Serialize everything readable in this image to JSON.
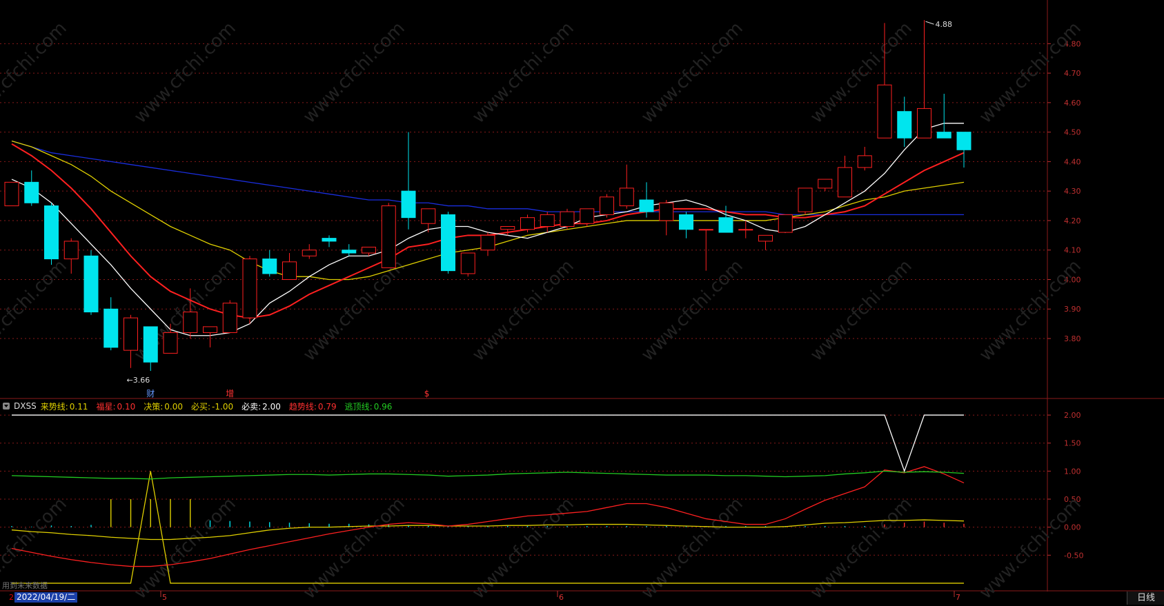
{
  "chart_data": [
    {
      "type": "candlestick",
      "ylim": [
        3.62,
        4.92
      ],
      "yticks": [
        "4.80",
        "4.70",
        "4.60",
        "4.50",
        "4.40",
        "4.30",
        "4.20",
        "4.10",
        "4.00",
        "3.90",
        "3.80"
      ],
      "candles": [
        {
          "o": 4.25,
          "h": 4.33,
          "l": 4.25,
          "c": 4.33
        },
        {
          "o": 4.33,
          "h": 4.37,
          "l": 4.25,
          "c": 4.26
        },
        {
          "o": 4.25,
          "h": 4.26,
          "l": 4.05,
          "c": 4.07
        },
        {
          "o": 4.07,
          "h": 4.14,
          "l": 4.02,
          "c": 4.13
        },
        {
          "o": 4.08,
          "h": 4.1,
          "l": 3.88,
          "c": 3.89
        },
        {
          "o": 3.9,
          "h": 3.94,
          "l": 3.76,
          "c": 3.77
        },
        {
          "o": 3.76,
          "h": 3.88,
          "l": 3.7,
          "c": 3.87
        },
        {
          "o": 3.84,
          "h": 3.84,
          "l": 3.69,
          "c": 3.72
        },
        {
          "o": 3.75,
          "h": 3.85,
          "l": 3.75,
          "c": 3.82
        },
        {
          "o": 3.82,
          "h": 3.97,
          "l": 3.8,
          "c": 3.89
        },
        {
          "o": 3.82,
          "h": 3.84,
          "l": 3.77,
          "c": 3.84
        },
        {
          "o": 3.82,
          "h": 3.93,
          "l": 3.82,
          "c": 3.92
        },
        {
          "o": 3.87,
          "h": 4.08,
          "l": 3.85,
          "c": 4.07
        },
        {
          "o": 4.07,
          "h": 4.1,
          "l": 4.01,
          "c": 4.02
        },
        {
          "o": 4.0,
          "h": 4.09,
          "l": 4.0,
          "c": 4.06
        },
        {
          "o": 4.08,
          "h": 4.12,
          "l": 4.07,
          "c": 4.1
        },
        {
          "o": 4.14,
          "h": 4.15,
          "l": 4.11,
          "c": 4.13
        },
        {
          "o": 4.1,
          "h": 4.12,
          "l": 4.08,
          "c": 4.09
        },
        {
          "o": 4.09,
          "h": 4.11,
          "l": 4.08,
          "c": 4.11
        },
        {
          "o": 4.04,
          "h": 4.26,
          "l": 4.04,
          "c": 4.25
        },
        {
          "o": 4.3,
          "h": 4.5,
          "l": 4.17,
          "c": 4.21
        },
        {
          "o": 4.19,
          "h": 4.24,
          "l": 4.16,
          "c": 4.24
        },
        {
          "o": 4.22,
          "h": 4.23,
          "l": 4.02,
          "c": 4.03
        },
        {
          "o": 4.02,
          "h": 4.09,
          "l": 4.01,
          "c": 4.09
        },
        {
          "o": 4.1,
          "h": 4.16,
          "l": 4.08,
          "c": 4.15
        },
        {
          "o": 4.17,
          "h": 4.18,
          "l": 4.15,
          "c": 4.18
        },
        {
          "o": 4.17,
          "h": 4.22,
          "l": 4.16,
          "c": 4.21
        },
        {
          "o": 4.18,
          "h": 4.23,
          "l": 4.16,
          "c": 4.22
        },
        {
          "o": 4.18,
          "h": 4.24,
          "l": 4.17,
          "c": 4.23
        },
        {
          "o": 4.19,
          "h": 4.24,
          "l": 4.18,
          "c": 4.24
        },
        {
          "o": 4.22,
          "h": 4.29,
          "l": 4.21,
          "c": 4.28
        },
        {
          "o": 4.25,
          "h": 4.39,
          "l": 4.24,
          "c": 4.31
        },
        {
          "o": 4.27,
          "h": 4.33,
          "l": 4.21,
          "c": 4.23
        },
        {
          "o": 4.2,
          "h": 4.27,
          "l": 4.15,
          "c": 4.26
        },
        {
          "o": 4.22,
          "h": 4.23,
          "l": 4.14,
          "c": 4.17
        },
        {
          "o": 4.17,
          "h": 4.17,
          "l": 4.03,
          "c": 4.17
        },
        {
          "o": 4.21,
          "h": 4.25,
          "l": 4.16,
          "c": 4.16
        },
        {
          "o": 4.17,
          "h": 4.2,
          "l": 4.14,
          "c": 4.17
        },
        {
          "o": 4.13,
          "h": 4.15,
          "l": 4.1,
          "c": 4.15
        },
        {
          "o": 4.16,
          "h": 4.22,
          "l": 4.16,
          "c": 4.22
        },
        {
          "o": 4.23,
          "h": 4.31,
          "l": 4.22,
          "c": 4.31
        },
        {
          "o": 4.31,
          "h": 4.34,
          "l": 4.3,
          "c": 4.34
        },
        {
          "o": 4.28,
          "h": 4.42,
          "l": 4.28,
          "c": 4.38
        },
        {
          "o": 4.38,
          "h": 4.45,
          "l": 4.37,
          "c": 4.42
        },
        {
          "o": 4.48,
          "h": 4.87,
          "l": 4.48,
          "c": 4.66
        },
        {
          "o": 4.57,
          "h": 4.62,
          "l": 4.45,
          "c": 4.48
        },
        {
          "o": 4.48,
          "h": 4.88,
          "l": 4.48,
          "c": 4.58
        },
        {
          "o": 4.5,
          "h": 4.63,
          "l": 4.48,
          "c": 4.48
        },
        {
          "o": 4.5,
          "h": 4.5,
          "l": 4.38,
          "c": 4.44
        }
      ],
      "ma_colors": [
        "#ffffff",
        "#ff2020",
        "#e0d000",
        "#1a2ee0"
      ],
      "ma_white": [
        4.34,
        4.31,
        4.26,
        4.19,
        4.12,
        4.05,
        3.97,
        3.9,
        3.83,
        3.81,
        3.81,
        3.82,
        3.85,
        3.92,
        3.96,
        4.01,
        4.05,
        4.08,
        4.08,
        4.1,
        4.14,
        4.17,
        4.18,
        4.18,
        4.16,
        4.15,
        4.14,
        4.16,
        4.18,
        4.21,
        4.22,
        4.23,
        4.25,
        4.26,
        4.27,
        4.25,
        4.22,
        4.2,
        4.17,
        4.16,
        4.18,
        4.22,
        4.26,
        4.3,
        4.36,
        4.44,
        4.51,
        4.53,
        4.53
      ],
      "ma_red": [
        4.46,
        4.42,
        4.37,
        4.31,
        4.24,
        4.16,
        4.08,
        4.01,
        3.96,
        3.93,
        3.9,
        3.88,
        3.87,
        3.88,
        3.91,
        3.95,
        3.98,
        4.01,
        4.04,
        4.07,
        4.11,
        4.12,
        4.14,
        4.15,
        4.15,
        4.16,
        4.17,
        4.18,
        4.19,
        4.19,
        4.2,
        4.22,
        4.23,
        4.24,
        4.24,
        4.24,
        4.23,
        4.22,
        4.22,
        4.21,
        4.21,
        4.22,
        4.23,
        4.25,
        4.29,
        4.33,
        4.37,
        4.4,
        4.43
      ],
      "ma_yellow": [
        4.47,
        4.45,
        4.42,
        4.39,
        4.35,
        4.3,
        4.26,
        4.22,
        4.18,
        4.15,
        4.12,
        4.1,
        4.06,
        4.03,
        4.01,
        4.01,
        4.0,
        4.0,
        4.01,
        4.03,
        4.05,
        4.07,
        4.09,
        4.1,
        4.11,
        4.13,
        4.15,
        4.16,
        4.17,
        4.18,
        4.19,
        4.2,
        4.2,
        4.2,
        4.2,
        4.2,
        4.2,
        4.2,
        4.2,
        4.21,
        4.22,
        4.23,
        4.25,
        4.27,
        4.28,
        4.3,
        4.31,
        4.32,
        4.33
      ],
      "ma_blue": [
        4.47,
        4.45,
        4.43,
        4.42,
        4.41,
        4.4,
        4.39,
        4.38,
        4.37,
        4.36,
        4.35,
        4.34,
        4.33,
        4.32,
        4.31,
        4.3,
        4.29,
        4.28,
        4.27,
        4.27,
        4.26,
        4.26,
        4.25,
        4.25,
        4.24,
        4.24,
        4.24,
        4.23,
        4.23,
        4.23,
        4.23,
        4.23,
        4.23,
        4.23,
        4.23,
        4.23,
        4.23,
        4.23,
        4.23,
        4.22,
        4.22,
        4.22,
        4.22,
        4.22,
        4.22,
        4.22,
        4.22,
        4.22,
        4.22
      ],
      "low_annotation": {
        "text": "←3.66",
        "value": 3.66,
        "index": 6
      },
      "high_annotation": {
        "text": "4.88",
        "value": 4.88,
        "index": 46
      },
      "event_markers": [
        {
          "text": "财",
          "index": 7,
          "color": "#6699ff"
        },
        {
          "text": "增",
          "index": 11,
          "color": "#ff3333"
        },
        {
          "text": "$",
          "index": 21,
          "color": "#ff3333"
        }
      ]
    },
    {
      "type": "line",
      "indicator": "DXSS",
      "ylim": [
        -1.05,
        2.05
      ],
      "yticks": [
        "2.00",
        "1.50",
        "1.00",
        "0.50",
        "0.00",
        "-0.50"
      ],
      "legend": [
        {
          "label": "来势线:",
          "value": "0.11",
          "color": "#e0d000"
        },
        {
          "label": "福星:",
          "value": "0.10",
          "color": "#ff3030"
        },
        {
          "label": "决策:",
          "value": "0.00",
          "color": "#e0d000"
        },
        {
          "label": "必买:",
          "value": "-1.00",
          "color": "#e0d000"
        },
        {
          "label": "必卖:",
          "value": "2.00",
          "color": "#ffffff"
        },
        {
          "label": "趋势线:",
          "value": "0.79",
          "color": "#ff3030"
        },
        {
          "label": "逃顶线:",
          "value": "0.96",
          "color": "#22cc22"
        }
      ],
      "white_line": [
        2.0,
        2.0,
        2.0,
        2.0,
        2.0,
        2.0,
        2.0,
        2.0,
        2.0,
        2.0,
        2.0,
        2.0,
        2.0,
        2.0,
        2.0,
        2.0,
        2.0,
        2.0,
        2.0,
        2.0,
        2.0,
        2.0,
        2.0,
        2.0,
        2.0,
        2.0,
        2.0,
        2.0,
        2.0,
        2.0,
        2.0,
        2.0,
        2.0,
        2.0,
        2.0,
        2.0,
        2.0,
        2.0,
        2.0,
        2.0,
        2.0,
        2.0,
        2.0,
        2.0,
        2.0,
        1.0,
        2.0,
        2.0,
        2.0
      ],
      "yellow_spike": [
        -1.0,
        -1.0,
        -1.0,
        -1.0,
        -1.0,
        -1.0,
        -1.0,
        1.0,
        -1.0,
        -1.0,
        -1.0,
        -1.0,
        -1.0,
        -1.0,
        -1.0,
        -1.0,
        -1.0,
        -1.0,
        -1.0,
        -1.0,
        -1.0,
        -1.0,
        -1.0,
        -1.0,
        -1.0,
        -1.0,
        -1.0,
        -1.0,
        -1.0,
        -1.0,
        -1.0,
        -1.0,
        -1.0,
        -1.0,
        -1.0,
        -1.0,
        -1.0,
        -1.0,
        -1.0,
        -1.0,
        -1.0,
        -1.0,
        -1.0,
        -1.0,
        -1.0,
        -1.0,
        -1.0,
        -1.0,
        -1.0
      ],
      "green_line": [
        0.92,
        0.91,
        0.9,
        0.89,
        0.88,
        0.87,
        0.87,
        0.86,
        0.88,
        0.89,
        0.9,
        0.91,
        0.92,
        0.93,
        0.94,
        0.94,
        0.93,
        0.94,
        0.95,
        0.95,
        0.94,
        0.93,
        0.91,
        0.92,
        0.93,
        0.95,
        0.96,
        0.97,
        0.98,
        0.97,
        0.96,
        0.95,
        0.94,
        0.93,
        0.93,
        0.93,
        0.92,
        0.92,
        0.91,
        0.9,
        0.91,
        0.92,
        0.95,
        0.97,
        1.0,
        0.98,
        0.99,
        0.98,
        0.96
      ],
      "red_line": [
        -0.38,
        -0.45,
        -0.52,
        -0.58,
        -0.63,
        -0.67,
        -0.7,
        -0.7,
        -0.67,
        -0.62,
        -0.56,
        -0.48,
        -0.4,
        -0.33,
        -0.26,
        -0.19,
        -0.12,
        -0.06,
        0.0,
        0.05,
        0.08,
        0.06,
        0.02,
        0.05,
        0.1,
        0.15,
        0.2,
        0.22,
        0.25,
        0.28,
        0.35,
        0.42,
        0.42,
        0.35,
        0.25,
        0.15,
        0.1,
        0.05,
        0.05,
        0.15,
        0.32,
        0.48,
        0.6,
        0.72,
        1.02,
        0.97,
        1.08,
        0.95,
        0.79
      ],
      "yellow_line": [
        -0.05,
        -0.08,
        -0.1,
        -0.13,
        -0.15,
        -0.18,
        -0.2,
        -0.22,
        -0.22,
        -0.2,
        -0.18,
        -0.15,
        -0.1,
        -0.05,
        -0.02,
        0.0,
        0.0,
        0.01,
        0.02,
        0.02,
        0.03,
        0.03,
        0.02,
        0.02,
        0.02,
        0.03,
        0.03,
        0.04,
        0.04,
        0.05,
        0.05,
        0.05,
        0.04,
        0.03,
        0.02,
        0.01,
        0.0,
        0.0,
        0.0,
        0.01,
        0.04,
        0.07,
        0.08,
        0.1,
        0.12,
        0.12,
        0.13,
        0.12,
        0.11
      ],
      "bars": [
        0.02,
        0.01,
        0.03,
        0.02,
        0.04,
        0.5,
        0.5,
        0.5,
        0.5,
        0.5,
        0.12,
        0.11,
        0.1,
        0.09,
        0.08,
        0.07,
        0.06,
        0.06,
        0.05,
        0.05,
        0.04,
        0.03,
        0.02,
        0.02,
        0.02,
        0.02,
        0.02,
        0.02,
        0.02,
        0.02,
        0.02,
        0.02,
        0.02,
        0.02,
        0.02,
        0.02,
        0.02,
        0.02,
        0.02,
        0.02,
        0.02,
        0.02,
        0.02,
        0.02,
        0.05,
        0.08,
        0.1,
        0.08,
        0.06
      ],
      "bar_colors": [
        "#00e5ee",
        "#00e5ee",
        "#00e5ee",
        "#00e5ee",
        "#00e5ee",
        "#e0d000",
        "#e0d000",
        "#e0d000",
        "#e0d000",
        "#e0d000",
        "#00e5ee",
        "#00e5ee",
        "#00e5ee",
        "#00e5ee",
        "#00e5ee",
        "#00e5ee",
        "#00e5ee",
        "#00e5ee",
        "#00e5ee",
        "#00e5ee",
        "#00e5ee",
        "#00e5ee",
        "#00e5ee",
        "#00e5ee",
        "#00e5ee",
        "#00e5ee",
        "#00e5ee",
        "#00e5ee",
        "#00e5ee",
        "#00e5ee",
        "#00e5ee",
        "#00e5ee",
        "#00e5ee",
        "#00e5ee",
        "#00e5ee",
        "#00e5ee",
        "#00e5ee",
        "#00e5ee",
        "#00e5ee",
        "#00e5ee",
        "#00e5ee",
        "#00e5ee",
        "#00e5ee",
        "#00e5ee",
        "#ff3030",
        "#ff3030",
        "#ff3030",
        "#ff3030",
        "#ff3030"
      ]
    }
  ],
  "header": {
    "indicator_name": "DXSS"
  },
  "bottom": {
    "date_prefix": "2",
    "current_date": "2022/04/19/二",
    "months": [
      {
        "text": "5",
        "index": 8
      },
      {
        "text": "6",
        "index": 28
      },
      {
        "text": "7",
        "index": 48
      }
    ],
    "period_label": "日线",
    "future_note": "用到未来数据"
  },
  "watermark": "www.cfchi.com",
  "colors": {
    "up": "#ff2020",
    "down": "#00e5ee",
    "grid": "#8b1a1a",
    "axis_text": "#c03030"
  }
}
